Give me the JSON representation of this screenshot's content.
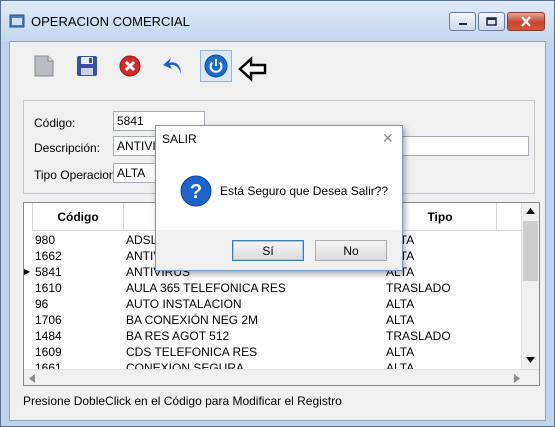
{
  "window": {
    "title": "OPERACION COMERCIAL"
  },
  "form": {
    "codigo_label": "Código:",
    "codigo_value": "5841",
    "descripcion_label": "Descripción:",
    "descripcion_value": "ANTIVIF",
    "tipo_label": "Tipo Operacion",
    "tipo_value": "ALTA"
  },
  "grid": {
    "columns": [
      "Código",
      "Tipo"
    ],
    "rows": [
      {
        "codigo": "980",
        "descripcion": "ADSL",
        "tipo": "ALTA"
      },
      {
        "codigo": "1662",
        "descripcion": "ANTIV",
        "tipo": "ALTA"
      },
      {
        "codigo": "5841",
        "descripcion": "ANTIVIRUS",
        "tipo": "ALTA"
      },
      {
        "codigo": "1610",
        "descripcion": "AULA 365 TELEFONICA RES",
        "tipo": "TRASLADO"
      },
      {
        "codigo": "96",
        "descripcion": "AUTO INSTALACION",
        "tipo": "ALTA"
      },
      {
        "codigo": "1706",
        "descripcion": "BA CONEXIÓN NEG 2M",
        "tipo": "ALTA"
      },
      {
        "codigo": "1484",
        "descripcion": "BA RES AGOT 512",
        "tipo": "TRASLADO"
      },
      {
        "codigo": "1609",
        "descripcion": "CDS TELEFONICA RES",
        "tipo": "ALTA"
      },
      {
        "codigo": "1661",
        "descripcion": "CONEXION SEGURA",
        "tipo": "ALTA"
      }
    ],
    "current_row_marker": "▶"
  },
  "status_text": "Presione DobleClick en el Código para Modificar el Registro",
  "dialog": {
    "title": "SALIR",
    "close_glyph": "✕",
    "icon_glyph": "?",
    "message": "Está Seguro que Desea Salir??",
    "yes_label": "Sí",
    "no_label": "No"
  },
  "colors": {
    "accent": "#1a5fa8",
    "close_red": "#c7452f",
    "exit_blue": "#1c6fd0"
  }
}
